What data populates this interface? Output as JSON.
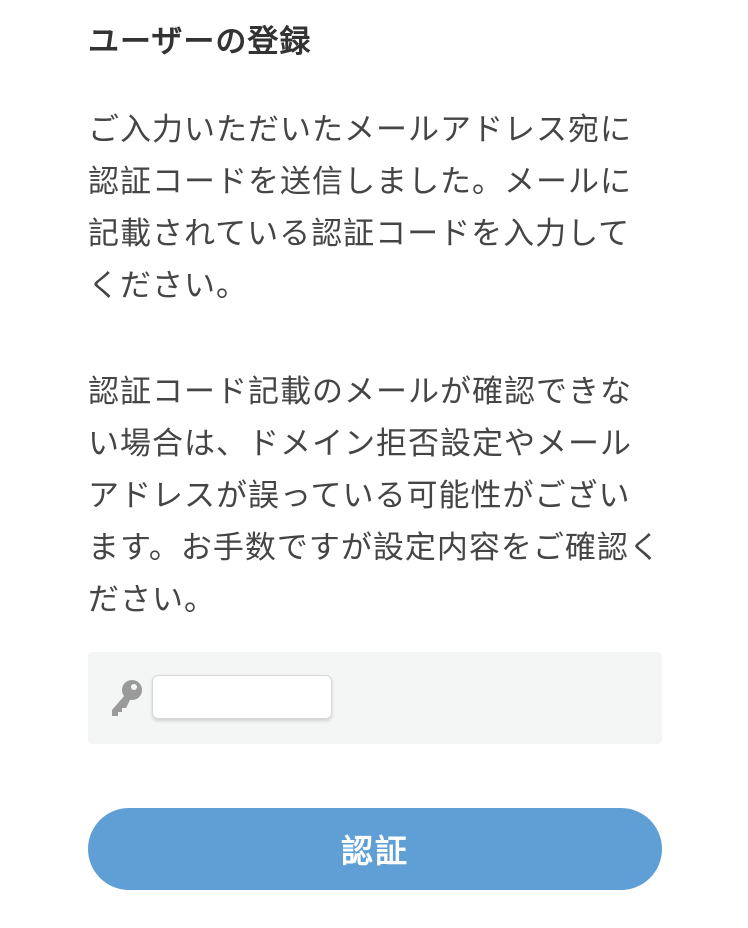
{
  "header": {
    "title": "ユーザーの登録"
  },
  "message": {
    "paragraph_1": [
      "ご入力いただいたメールアドレス宛に",
      "認証コードを送信しました。メールに",
      "記載されている認証コードを入力して",
      "ください。"
    ],
    "paragraph_2": [
      "認証コード記載のメールが確認できな",
      "い場合は、ドメイン拒否設定やメール",
      "アドレスが誤っている可能性がござい",
      "ます。お手数ですが設定内容をご確認く",
      "ださい。"
    ]
  },
  "form": {
    "code_icon": "key-icon",
    "code_value": "",
    "submit_label": "認証"
  },
  "colors": {
    "button_bg": "#5f9fd5",
    "panel_bg": "#f4f6f6",
    "icon": "#9a9a9a"
  }
}
